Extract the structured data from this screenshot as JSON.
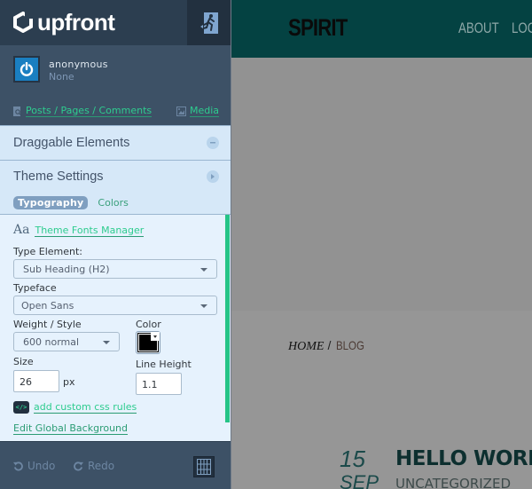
{
  "sidebar": {
    "brand": "upfront",
    "exit_icon": "exit-running-man-icon",
    "user": {
      "name": "anonymous",
      "role": "None",
      "avatar_icon": "power-icon"
    },
    "links": {
      "posts": "Posts / Pages / Comments",
      "media": "Media"
    },
    "panels": {
      "draggable": {
        "title": "Draggable Elements"
      },
      "theme": {
        "title": "Theme Settings",
        "tabs": [
          {
            "label": "Typography",
            "active": true
          },
          {
            "label": "Colors",
            "active": false
          }
        ]
      }
    },
    "typography": {
      "fonts_manager": "Theme Fonts Manager",
      "fonts_manager_glyph": "Aa",
      "type_element_label": "Type Element:",
      "type_element_value": "Sub Heading (H2)",
      "typeface_label": "Typeface",
      "typeface_value": "Open Sans",
      "weight_label": "Weight / Style",
      "weight_value": "600 normal",
      "color_label": "Color",
      "color_value": "#000000",
      "size_label": "Size",
      "size_value": "26",
      "size_unit": "px",
      "line_height_label": "Line Height",
      "line_height_value": "1.1",
      "custom_css": "add custom css rules",
      "custom_css_glyph": "</>",
      "global_bg": "Edit Global Background"
    },
    "bottom": {
      "undo": "Undo",
      "redo": "Redo"
    }
  },
  "site": {
    "title": "SPIRIT",
    "nav": [
      "ABOUT",
      "LOG"
    ],
    "breadcrumb": {
      "home": "HOME",
      "sep": "/",
      "current": "BLOG"
    },
    "post": {
      "day": "15",
      "month": "SEP",
      "title": "HELLO WORL",
      "category": "UNCATEGORIZED"
    }
  },
  "colors": {
    "accent_green": "#25c487",
    "sidebar_dark": "#2c3e50",
    "sidebar": "#3d5166",
    "panel": "#d6e8f8",
    "site_header": "#044242"
  }
}
